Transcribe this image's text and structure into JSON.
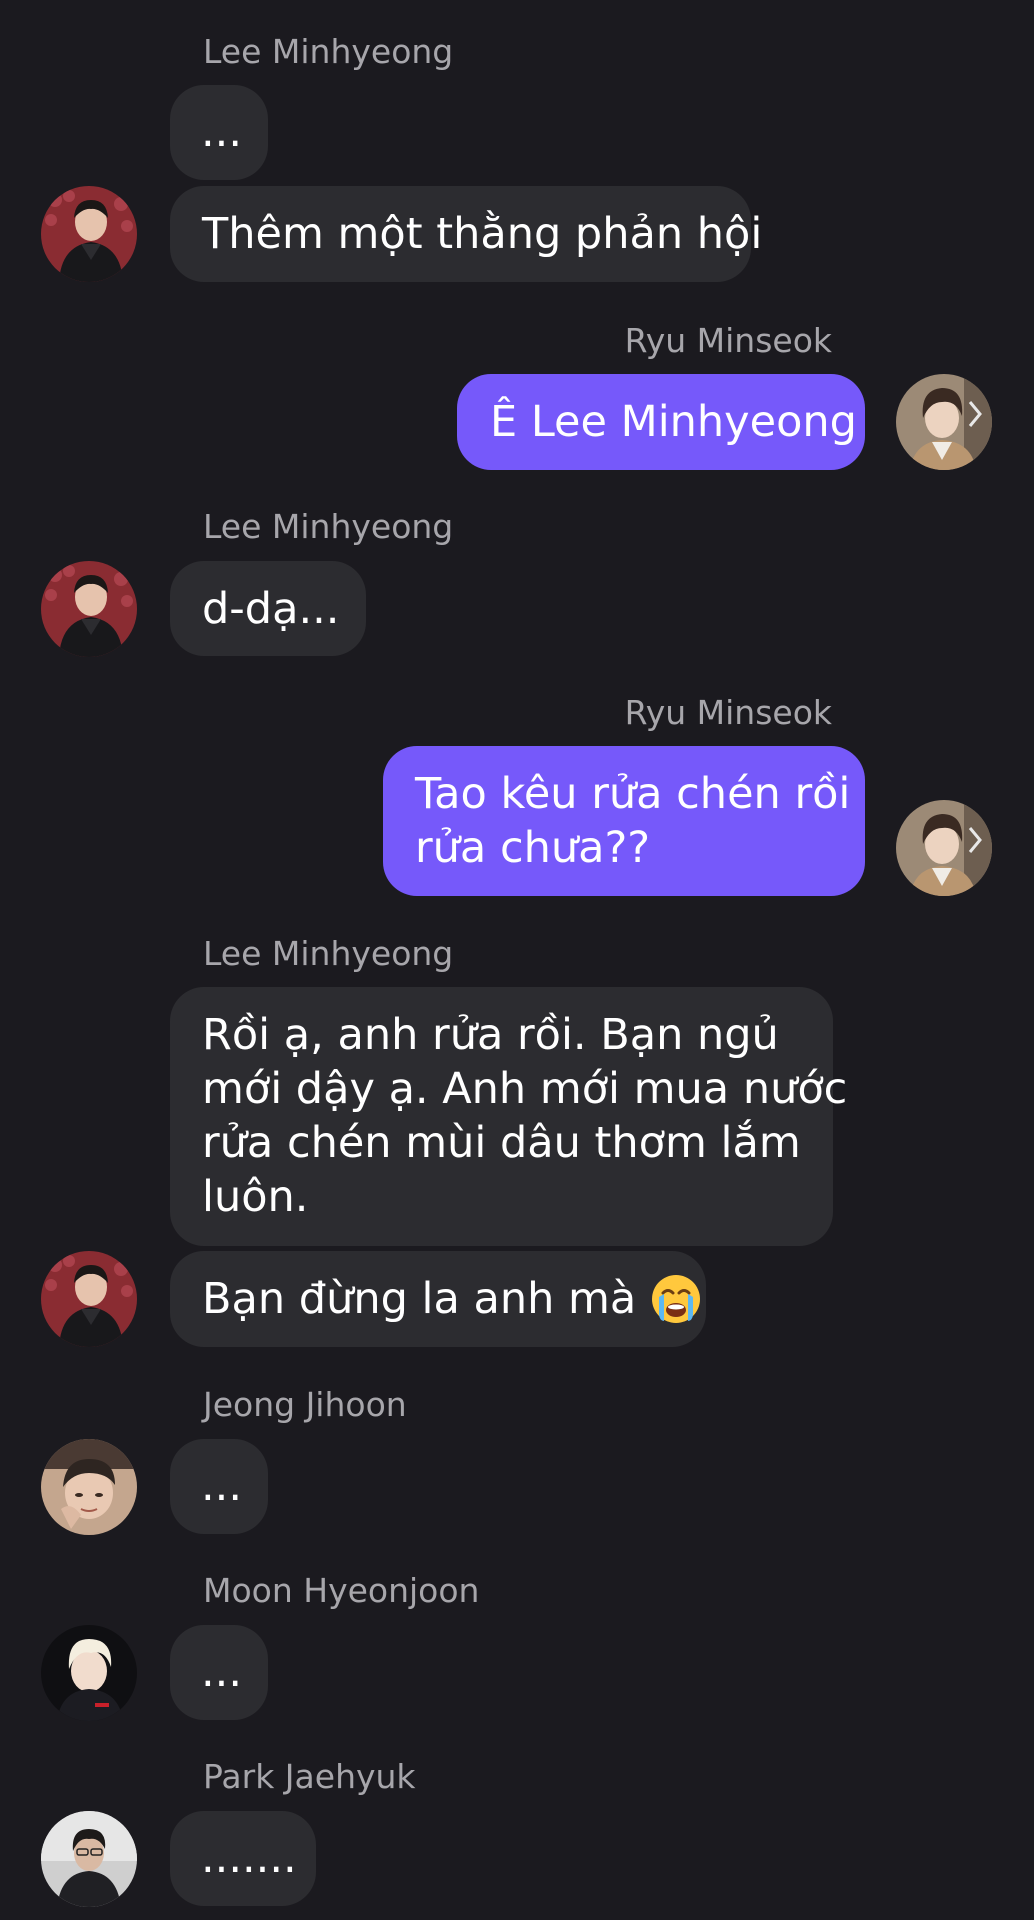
{
  "conversation": {
    "messages": [
      {
        "sender": "Lee Minhyeong",
        "lines": [
          "..."
        ]
      },
      {
        "sender": "",
        "lines": [
          "Thêm một thằng phản hội"
        ]
      },
      {
        "sender": "Ryu Minseok",
        "lines": [
          "Ê Lee Minhyeong"
        ]
      },
      {
        "sender": "Lee Minhyeong",
        "lines": [
          "d-dạ..."
        ]
      },
      {
        "sender": "Ryu Minseok",
        "lines": [
          "Tao kêu rửa chén rồi",
          "rửa chưa??"
        ]
      },
      {
        "sender": "Lee Minhyeong",
        "lines": [
          "Rồi ạ, anh rửa rồi. Bạn ngủ",
          "mới dậy ạ. Anh mới mua nước",
          "rửa chén mùi dâu thơm lắm",
          "luôn."
        ]
      },
      {
        "sender": "",
        "lines": [
          "Bạn đừng la anh mà"
        ],
        "emoji": "loudly-crying-face-emoji"
      },
      {
        "sender": "Jeong Jihoon",
        "lines": [
          "..."
        ]
      },
      {
        "sender": "Moon Hyeonjoon",
        "lines": [
          "..."
        ]
      },
      {
        "sender": "Park Jaehyuk",
        "lines": [
          "......."
        ]
      }
    ]
  },
  "colors": {
    "background": "#1b1a1f",
    "incoming_bubble": "#2c2c30",
    "outgoing_bubble": "#7659fa",
    "sender_name": "#a7a6ab",
    "message_text": "#ffffff"
  }
}
